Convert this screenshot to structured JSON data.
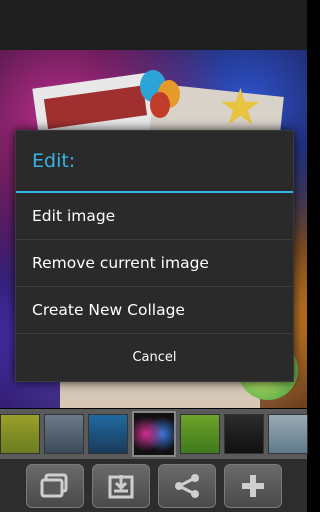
{
  "dialog": {
    "title": "Edit:",
    "options": [
      {
        "label": "Edit image"
      },
      {
        "label": "Remove current image"
      },
      {
        "label": "Create New Collage"
      }
    ],
    "cancel_label": "Cancel"
  },
  "toolbar": {
    "buttons": [
      {
        "icon": "layers-icon"
      },
      {
        "icon": "save-icon"
      },
      {
        "icon": "share-icon"
      },
      {
        "icon": "add-icon"
      }
    ]
  },
  "colors": {
    "accent": "#35b5e5",
    "dialog_bg": "#2a2a2a"
  }
}
